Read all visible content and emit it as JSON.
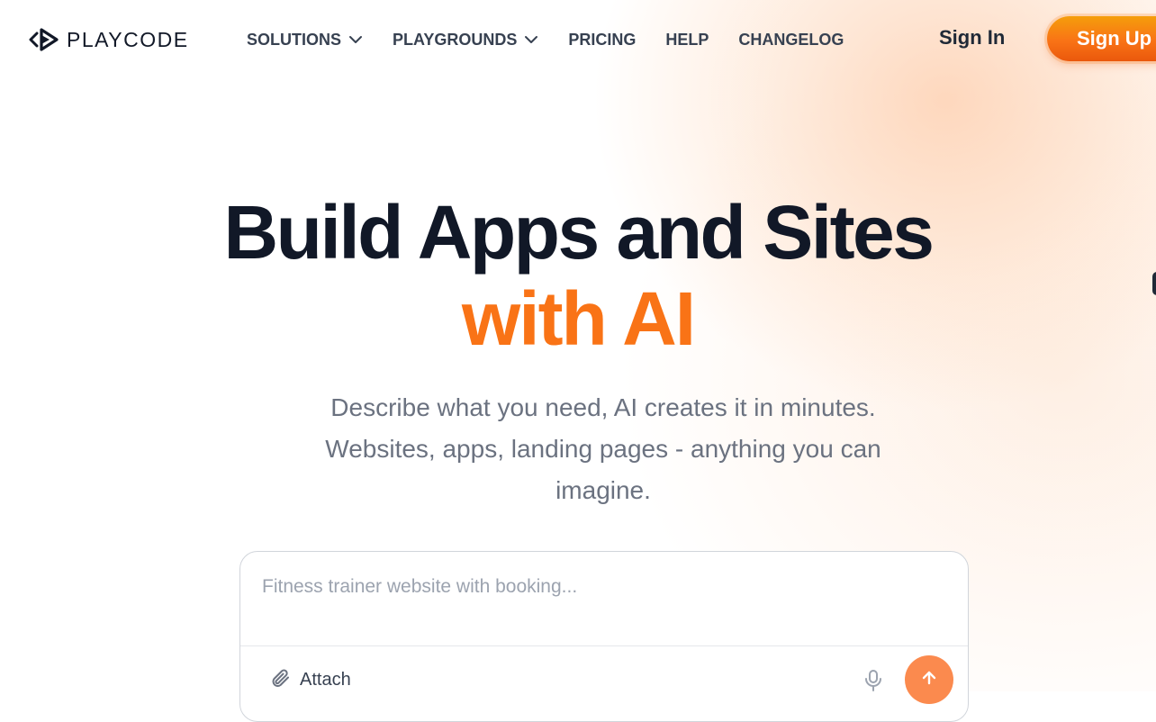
{
  "brand": {
    "name": "PLAYCODE"
  },
  "nav": {
    "items": [
      {
        "label": "SOLUTIONS",
        "has_dropdown": true
      },
      {
        "label": "PLAYGROUNDS",
        "has_dropdown": true
      },
      {
        "label": "PRICING",
        "has_dropdown": false
      },
      {
        "label": "HELP",
        "has_dropdown": false
      },
      {
        "label": "CHANGELOG",
        "has_dropdown": false
      }
    ],
    "sign_in": "Sign In",
    "sign_up": "Sign Up"
  },
  "hero": {
    "title_line1": "Build Apps and Sites",
    "title_line2": "with AI",
    "subtitle": "Describe what you need, AI creates it in minutes. Websites, apps, landing pages - anything you can imagine."
  },
  "prompt": {
    "placeholder": "Fitness trainer website with booking...",
    "attach_label": "Attach"
  },
  "icons": {
    "logo": "playcode-logo-icon",
    "dropdown": "chevron-down-icon",
    "attach": "paperclip-icon",
    "mic": "microphone-icon",
    "send": "arrow-up-icon"
  },
  "colors": {
    "accent": "#f97316",
    "title": "#111827",
    "subtitle": "#6b7280",
    "send_button": "#fb8a4e"
  }
}
